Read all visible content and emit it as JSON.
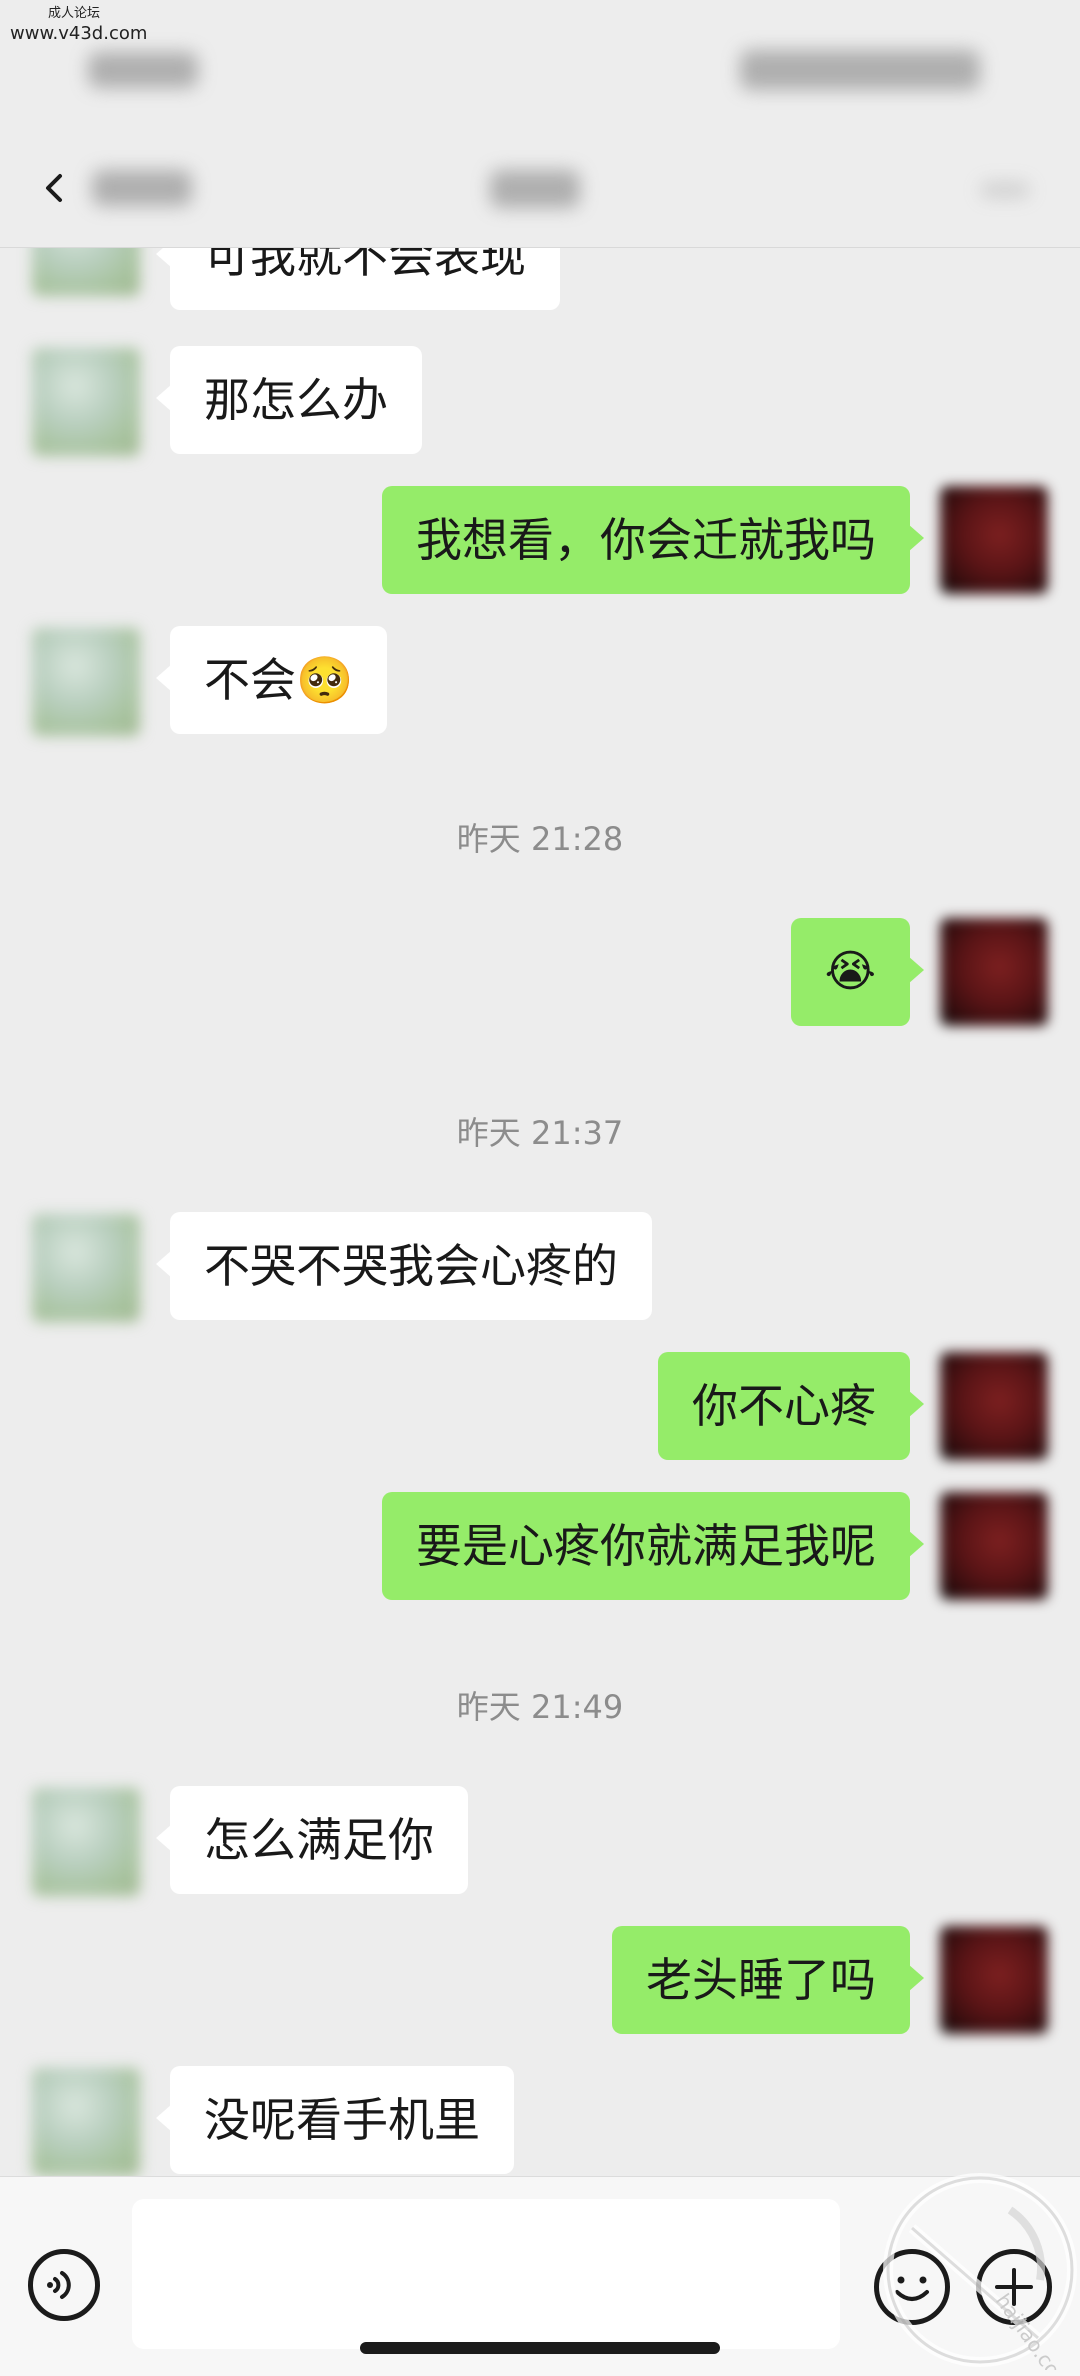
{
  "watermark": {
    "line1": "成人论坛",
    "line2": "www.v43d.com",
    "corner_text": "haijiao.com"
  },
  "nav": {
    "back_icon": "chevron-left-icon"
  },
  "messages": [
    {
      "side": "in",
      "text": "可我就不会表现",
      "cut": true
    },
    {
      "side": "in",
      "text": "那怎么办"
    },
    {
      "side": "out",
      "text": "我想看，你会迁就我吗"
    },
    {
      "side": "in",
      "text": "不会🥺"
    },
    {
      "side": "time",
      "text": "昨天 21:28"
    },
    {
      "side": "out",
      "text": "😭"
    },
    {
      "side": "time",
      "text": "昨天 21:37"
    },
    {
      "side": "in",
      "text": "不哭不哭我会心疼的"
    },
    {
      "side": "out",
      "text": "你不心疼"
    },
    {
      "side": "out",
      "text": "要是心疼你就满足我呢"
    },
    {
      "side": "time",
      "text": "昨天 21:49"
    },
    {
      "side": "in",
      "text": "怎么满足你"
    },
    {
      "side": "out",
      "text": "老头睡了吗"
    },
    {
      "side": "in",
      "text": "没呢看手机里"
    }
  ],
  "input_bar": {
    "voice_icon": "voice-icon",
    "emoji_icon": "emoji-icon",
    "plus_icon": "plus-icon",
    "input_value": ""
  },
  "colors": {
    "background": "#ededed",
    "bubble_in": "#ffffff",
    "bubble_out": "#95ec69",
    "timestamp": "#8c8c8c"
  }
}
